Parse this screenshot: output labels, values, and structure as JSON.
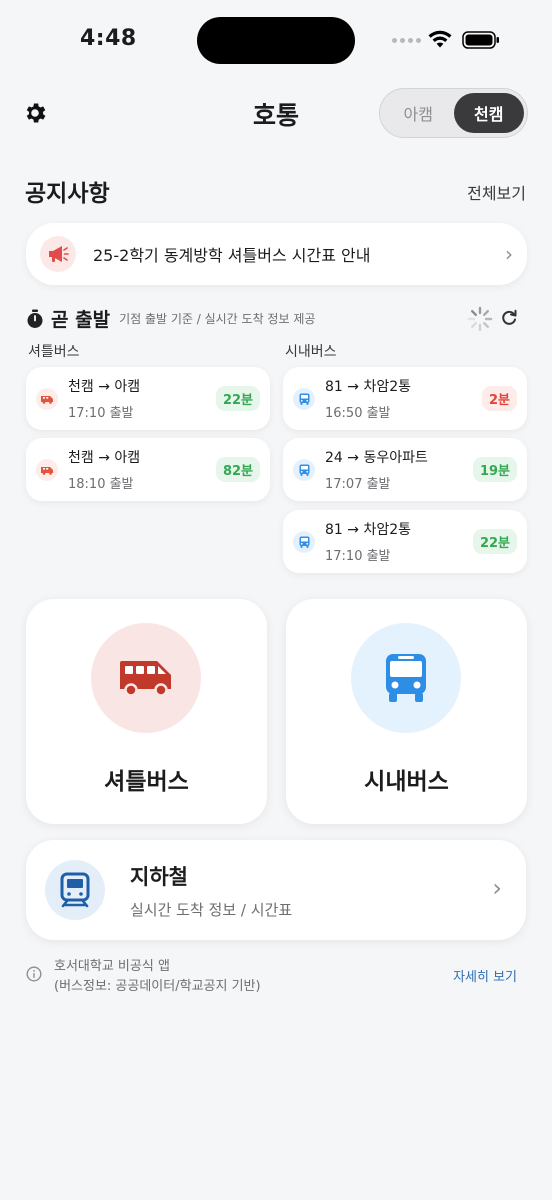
{
  "status_bar": {
    "time": "4:48"
  },
  "header": {
    "title": "호통",
    "campus_toggle": {
      "options": [
        "아캠",
        "천캠"
      ],
      "selected": "천캠"
    }
  },
  "notice": {
    "title": "공지사항",
    "see_all": "전체보기",
    "item": "25-2학기 동계방학 셔틀버스 시간표 안내"
  },
  "departures": {
    "title": "곧 출발",
    "subtitle": "기점 출발 기준 / 실시간 도착 정보 제공",
    "shuttle": {
      "label": "셔틀버스",
      "items": [
        {
          "route": "천캠 → 아캠",
          "time": "17:10 출발",
          "remaining": "22분",
          "status_color": "green"
        },
        {
          "route": "천캠 → 아캠",
          "time": "18:10 출발",
          "remaining": "82분",
          "status_color": "green"
        }
      ]
    },
    "city": {
      "label": "시내버스",
      "items": [
        {
          "route": "81 → 차암2통",
          "time": "16:50 출발",
          "remaining": "2분",
          "status_color": "red"
        },
        {
          "route": "24 → 동우아파트",
          "time": "17:07 출발",
          "remaining": "19분",
          "status_color": "green"
        },
        {
          "route": "81 → 차암2통",
          "time": "17:10 출발",
          "remaining": "22분",
          "status_color": "green"
        }
      ]
    }
  },
  "tiles": {
    "shuttle": {
      "label": "셔틀버스",
      "icon": "shuttle-van-icon",
      "color": "#c0392b"
    },
    "city": {
      "label": "시내버스",
      "icon": "city-bus-icon",
      "color": "#2e8ee6"
    }
  },
  "subway": {
    "title": "지하철",
    "subtitle": "실시간 도착 정보 / 시간표",
    "icon": "subway-train-icon",
    "color": "#1f5fa8"
  },
  "footer": {
    "line1": "호서대학교 비공식 앱",
    "line2": "(버스정보: 공공데이터/학교공지 기반)",
    "link": "자세히 보기"
  }
}
